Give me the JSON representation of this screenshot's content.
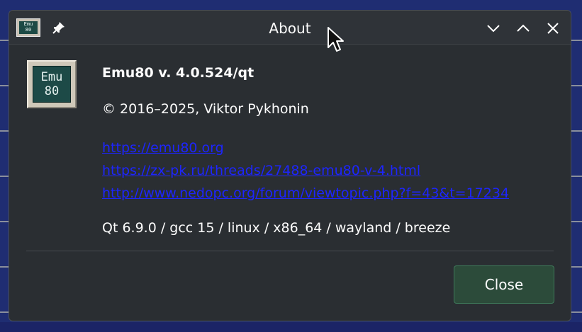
{
  "window": {
    "title": "About",
    "app_icon": {
      "name": "emu80-icon",
      "line1": "Emu",
      "line2": "80"
    },
    "buttons": {
      "pin": "pin-icon",
      "minimize": "chevron-down-icon",
      "maximize": "chevron-up-icon",
      "close": "close-icon"
    }
  },
  "about": {
    "logo": {
      "line1": "Emu",
      "line2": "80"
    },
    "heading": "Emu80 v. 4.0.524/qt",
    "copyright": "© 2016–2025, Viktor Pykhonin",
    "links": [
      "https://emu80.org",
      "https://zx-pk.ru/threads/27488-emu80-v-4.html",
      "http://www.nedopc.org/forum/viewtopic.php?f=43&t=17234"
    ],
    "build_info": "Qt 6.9.0 / gcc 15 / linux / x86_64 / wayland / breeze",
    "close_label": "Close"
  },
  "colors": {
    "window_bg": "#2a2e32",
    "titlebar_bg": "#2f3338",
    "link": "#1d25ff",
    "button_bg": "#2c4b3a",
    "button_border": "#3f7a5a",
    "text": "#fcfcfc"
  }
}
